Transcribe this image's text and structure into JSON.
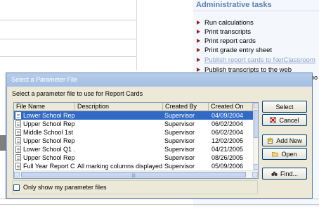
{
  "background": {
    "heading": "Administrative tasks",
    "tasks": [
      {
        "label": "Run calculations"
      },
      {
        "label": "Print transcripts"
      },
      {
        "label": "Print report cards"
      },
      {
        "label": "Print grade entry sheet"
      },
      {
        "label": "Publish report cards to NetClassroom"
      },
      {
        "label": "Publish transcripts to the web"
      }
    ],
    "edge_text": "roo"
  },
  "dialog": {
    "title": "Select a Parameter File",
    "prompt": "Select a parameter file to use for Report Cards",
    "columns": [
      "File Name",
      "Description",
      "Created By",
      "Created On"
    ],
    "rows": [
      {
        "name": "Lower School Rep...",
        "description": "",
        "created_by": "Supervisor",
        "created_on": "04/09/2004",
        "selected": true
      },
      {
        "name": "Upper School Rep...",
        "description": "",
        "created_by": "Supervisor",
        "created_on": "06/02/2004"
      },
      {
        "name": "Middle School 1st ...",
        "description": "",
        "created_by": "Supervisor",
        "created_on": "06/02/2004"
      },
      {
        "name": "Upper School Rep...",
        "description": "",
        "created_by": "Supervisor",
        "created_on": "12/02/2005"
      },
      {
        "name": "Lower School Q1 ...",
        "description": "",
        "created_by": "Supervisor",
        "created_on": "04/21/2005"
      },
      {
        "name": "Upper School Rep...",
        "description": "",
        "created_by": "Supervisor",
        "created_on": "08/26/2005"
      },
      {
        "name": "Full Year Report C...",
        "description": "All marking columns displayed",
        "created_by": "Supervisor",
        "created_on": "05/09/2006"
      }
    ],
    "buttons": {
      "select": "Select",
      "cancel": "Cancel",
      "add_new": "Add New",
      "open": "Open",
      "find": "Find..."
    },
    "checkbox_label": "Only show my parameter files",
    "checkbox_checked": false
  },
  "colors": {
    "selection": "#316ac5",
    "title_gradient": "#a4bfe4",
    "task_arrow": "#a11818",
    "heading": "#5b7fb8"
  }
}
